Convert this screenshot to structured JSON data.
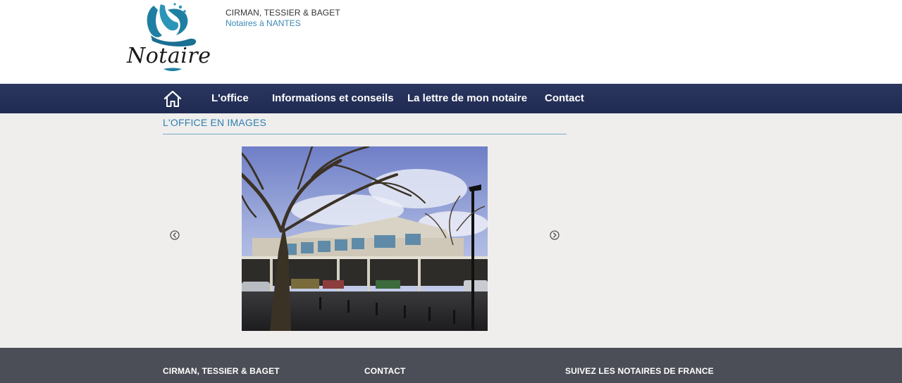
{
  "header": {
    "logo_text": "Notaire",
    "office_name": "CIRMAN, TESSIER & BAGET",
    "office_subtitle": "Notaires à NANTES"
  },
  "nav": {
    "home_icon": "home-icon",
    "items": [
      {
        "label": "L'office"
      },
      {
        "label": "Informations et conseils"
      },
      {
        "label": "La lettre de mon notaire"
      },
      {
        "label": "Contact"
      }
    ]
  },
  "gallery": {
    "title": "L'OFFICE EN IMAGES",
    "prev_icon": "chevron-left-circle-icon",
    "next_icon": "chevron-right-circle-icon"
  },
  "footer": {
    "col1_title": "CIRMAN, TESSIER & BAGET",
    "col2_title": "CONTACT",
    "col3_title": "SUIVEZ LES NOTAIRES DE FRANCE"
  },
  "colors": {
    "nav_bg": "#25305a",
    "accent": "#2f7fb0",
    "footer_bg": "#4b4e56",
    "page_bg": "#efeeed"
  }
}
